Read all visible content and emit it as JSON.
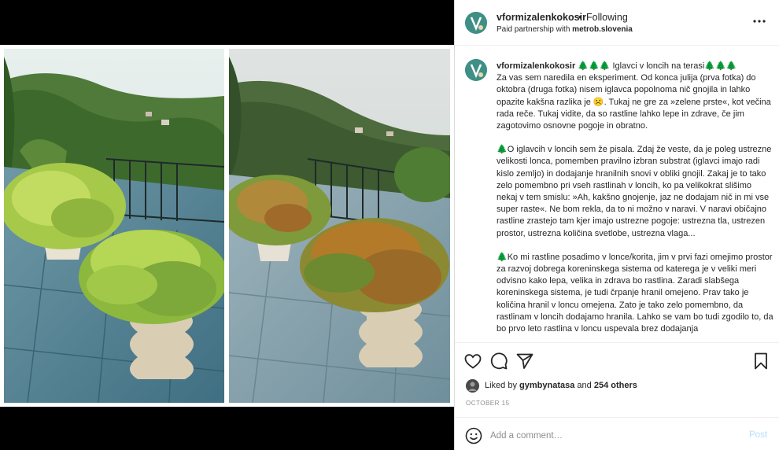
{
  "post": {
    "username": "vformizalenkokosir",
    "dot": "•",
    "follow_status": "Following",
    "paid_label": "Paid partnership with",
    "partner": "metrob.slovenia"
  },
  "caption": {
    "username": "vformizalenkokosir",
    "title_prefix": "🌲🌲🌲",
    "title": "Iglavci v loncih na terasi",
    "title_suffix": "🌲🌲🌲",
    "p1_text": "Za vas sem naredila en eksperiment. Od konca julija (prva fotka) do oktobra (druga fotka) nisem iglavca popolnoma nič gnojila in lahko opazite kakšna razlika je",
    "p1_emoji": "☹️",
    "p1_rest": ". Tukaj ne gre za »zelene prste«, kot večina rada reče. Tukaj vidite, da so rastline lahko lepe in zdrave, če jim zagotovimo osnovne pogoje in obratno.",
    "p2_prefix": "🌲",
    "p2": "O iglavcih v loncih sem že pisala. Zdaj že veste, da je poleg ustrezne velikosti lonca, pomemben pravilno izbran substrat (iglavci imajo radi kislo zemljo) in dodajanje hranilnih snovi v obliki gnojil. Zakaj je to tako zelo pomembno pri vseh rastlinah v loncih, ko pa velikokrat slišimo nekaj v tem smislu: »Ah, kakšno gnojenje, jaz ne dodajam nič in mi vse super raste«. Ne bom rekla, da to ni možno v naravi. V naravi običajno rastline zrastejo tam kjer imajo ustrezne pogoje: ustrezna tla, ustrezen prostor, ustrezna količina svetlobe, ustrezna vlaga...",
    "p3_prefix": "🌲",
    "p3": "Ko mi rastline posadimo v lonce/korita, jim v prvi fazi omejimo prostor za razvoj dobrega koreninskega sistema od katerega je v veliki meri odvisno kako lepa, velika in zdrava bo rastlina. Zaradi slabšega koreninskega sistema, je tudi črpanje hranil omejeno. Prav tako je količina hranil v loncu omejena. Zato je tako zelo pomembno, da rastlinam v loncih dodajamo hranila. Lahko se vam bo tudi zgodilo to, da bo prvo leto rastlina v loncu uspevala brez dodajanja"
  },
  "icons": {
    "more": "more-horizontal-icon",
    "like": "heart-icon",
    "comment": "comment-icon",
    "share": "paper-plane-icon",
    "save": "bookmark-icon",
    "emoji": "smiley-icon"
  },
  "likes": {
    "prefix": "Liked by",
    "user": "gymbynatasa",
    "mid": "and",
    "others": "254 others"
  },
  "date": "OCTOBER 15",
  "comment": {
    "placeholder": "Add a comment…",
    "post_label": "Post"
  },
  "colors": {
    "accent": "#0095f6",
    "post_disabled": "#b2dffc",
    "avatar_bg": "#3f8f86"
  }
}
